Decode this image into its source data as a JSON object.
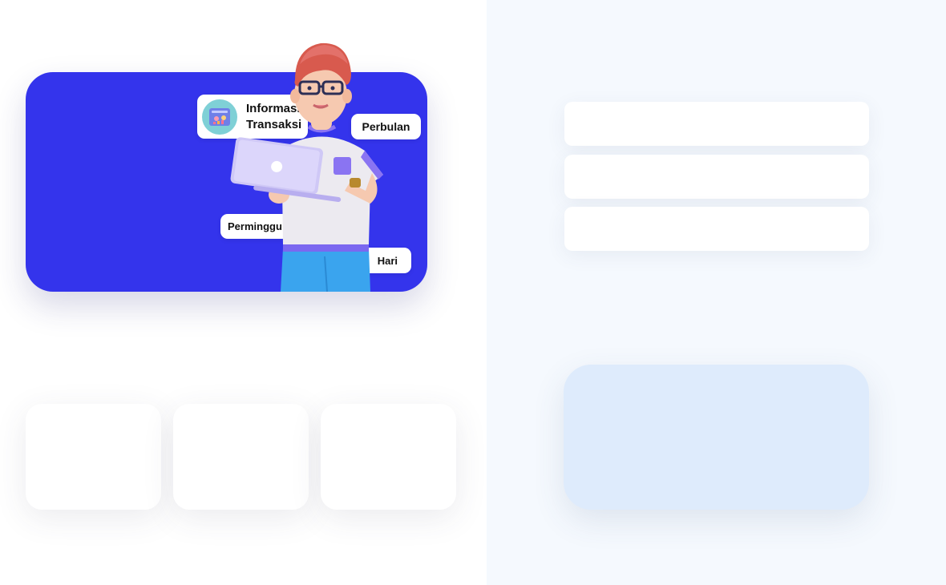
{
  "hero": {
    "info_title": "Informasi Transaksi",
    "periods": {
      "monthly": "Perbulan",
      "weekly": "Perminggu",
      "daily": "Hari"
    }
  },
  "colors": {
    "hero_background": "#3434ec",
    "right_pane_background": "#f5f9fe",
    "feature_box": "#deebfc"
  },
  "icons": {
    "info_thumb": "chart-board-icon",
    "laptop_logo": "logo-icon"
  }
}
